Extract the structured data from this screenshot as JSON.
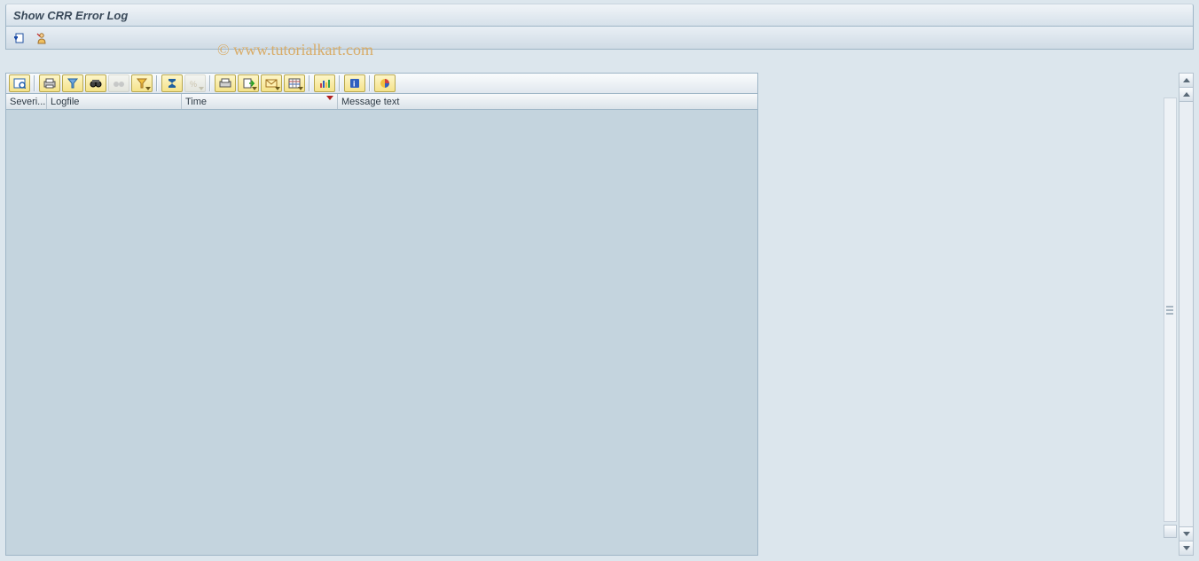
{
  "title": "Show CRR Error Log",
  "watermark": "© www.tutorialkart.com",
  "app_toolbar": {
    "btn1": "refresh",
    "btn2": "user-display"
  },
  "alv_toolbar": {
    "details": "Details",
    "print": "Print",
    "filter": "Find",
    "find": "Find Next",
    "find_next": "Set Filter",
    "sort_asc": "Filter",
    "total": "Total",
    "subtotal": "Subtotal",
    "print2": "Print Preview",
    "export": "Local File",
    "mail": "Mail Recipient",
    "layout": "Change Layout",
    "graphic": "Graphic",
    "info": "Information",
    "abc": "ABC Analysis"
  },
  "columns": {
    "severity": "Severi...",
    "logfile": "Logfile",
    "time": "Time",
    "message": "Message text"
  }
}
